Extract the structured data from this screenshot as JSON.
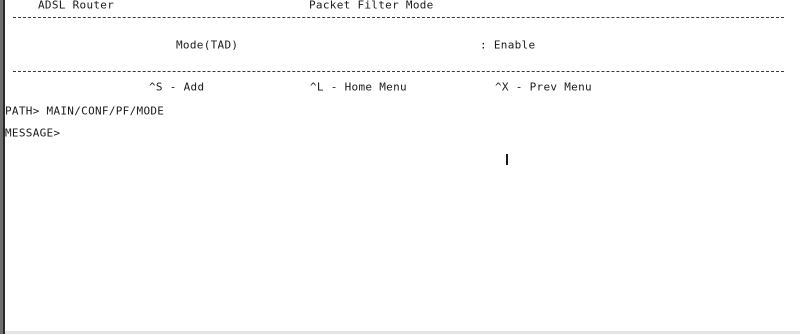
{
  "header": {
    "product": "ADSL Router",
    "screen_title": "Packet Filter Mode"
  },
  "setting": {
    "label": "Mode(TAD)",
    "value": ": Enable"
  },
  "keys": {
    "add": "^S - Add",
    "home": "^L - Home Menu",
    "prev": "^X - Prev Menu"
  },
  "path": "PATH> MAIN/CONF/PF/MODE",
  "message": "MESSAGE>"
}
